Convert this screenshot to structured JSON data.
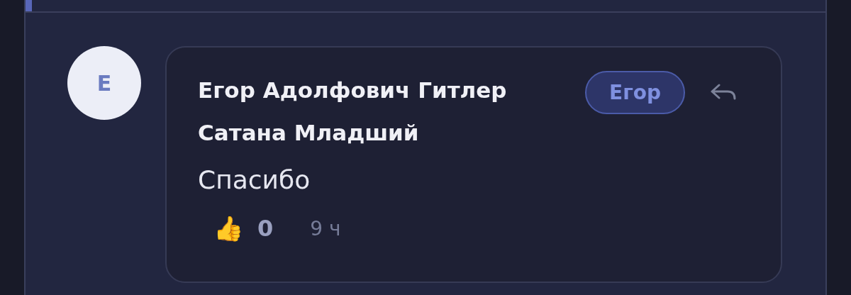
{
  "comment": {
    "avatar_letter": "Е",
    "author_lines": [
      "Егор Адолфович Гитлер",
      "Сатана Младший"
    ],
    "badge": "Егор",
    "text": "Спасибо",
    "reaction_emoji": "👍",
    "likes": "0",
    "time": "9 ч"
  }
}
